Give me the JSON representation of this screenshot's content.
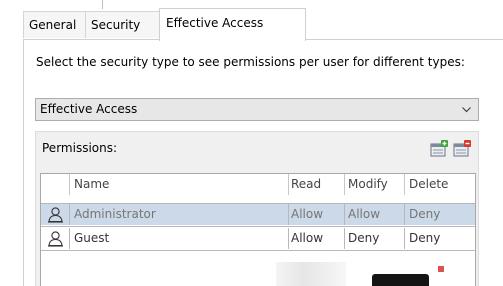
{
  "tabs": {
    "general": "General",
    "security": "Security",
    "effective_access": "Effective Access"
  },
  "description": "Select the security type to see permissions per user for different types:",
  "security_type_select": {
    "selected": "Effective Access"
  },
  "permissions": {
    "label": "Permissions:",
    "columns": {
      "name": "Name",
      "read": "Read",
      "modify": "Modify",
      "delete": "Delete"
    },
    "rows": [
      {
        "name": "Administrator",
        "read": "Allow",
        "modify": "Allow",
        "delete": "Deny",
        "selected": true,
        "icon": "user-icon"
      },
      {
        "name": "Guest",
        "read": "Allow",
        "modify": "Deny",
        "delete": "Deny",
        "selected": false,
        "icon": "user-icon"
      }
    ]
  },
  "icons": [
    "add-user-icon",
    "remove-user-icon",
    "chevron-down-icon",
    "user-icon"
  ],
  "colors": {
    "selected_row": "#cbd9e8",
    "dropdown_bg": "#e7e7e7",
    "panel_bg": "#f0f0f0"
  }
}
